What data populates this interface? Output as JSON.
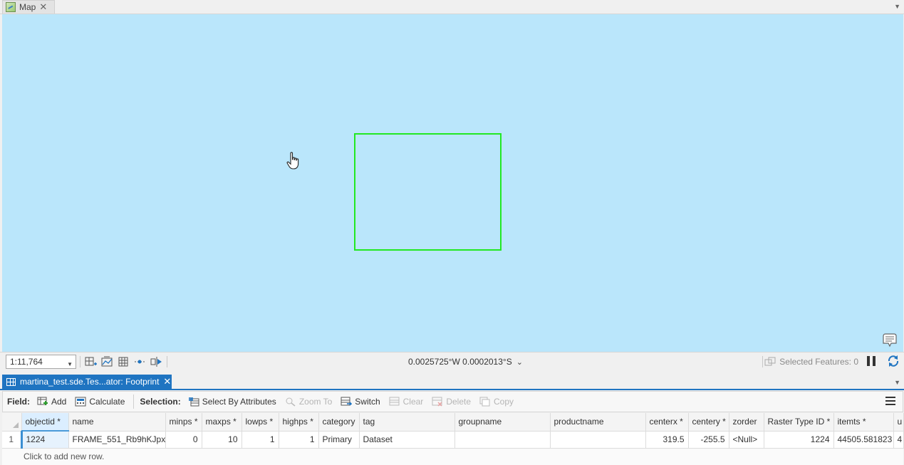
{
  "map_tab": {
    "label": "Map",
    "close": "✕"
  },
  "map": {
    "scale": "1:11,764",
    "coordinates": "0.0025725°W 0.0002013°S",
    "selected_features": "Selected Features: 0",
    "footprint_color": "#22e822",
    "background_color": "#bae6fb"
  },
  "table_tab": {
    "label": "martina_test.sde.Tes...ator: Footprint",
    "close": "✕",
    "accent": "#1f74c1"
  },
  "toolbar": {
    "field_label": "Field:",
    "add": "Add",
    "calculate": "Calculate",
    "selection_label": "Selection:",
    "select_by_attributes": "Select By Attributes",
    "zoom_to": "Zoom To",
    "switch": "Switch",
    "clear": "Clear",
    "delete": "Delete",
    "copy": "Copy"
  },
  "table": {
    "columns": [
      "objectid *",
      "name",
      "minps *",
      "maxps *",
      "lowps *",
      "highps *",
      "category",
      "tag",
      "groupname",
      "productname",
      "centerx *",
      "centery *",
      "zorder",
      "Raster Type ID *",
      "itemts *",
      "u"
    ],
    "rows": [
      {
        "rownum": "1",
        "cells": [
          "1224",
          "FRAME_551_Rb9hKJpxN",
          "0",
          "10",
          "1",
          "1",
          "Primary",
          "Dataset",
          "",
          "",
          "319.5",
          "-255.5",
          "<Null>",
          "1224",
          "44505.581823",
          "4"
        ]
      }
    ],
    "add_row_text": "Click to add new row."
  }
}
